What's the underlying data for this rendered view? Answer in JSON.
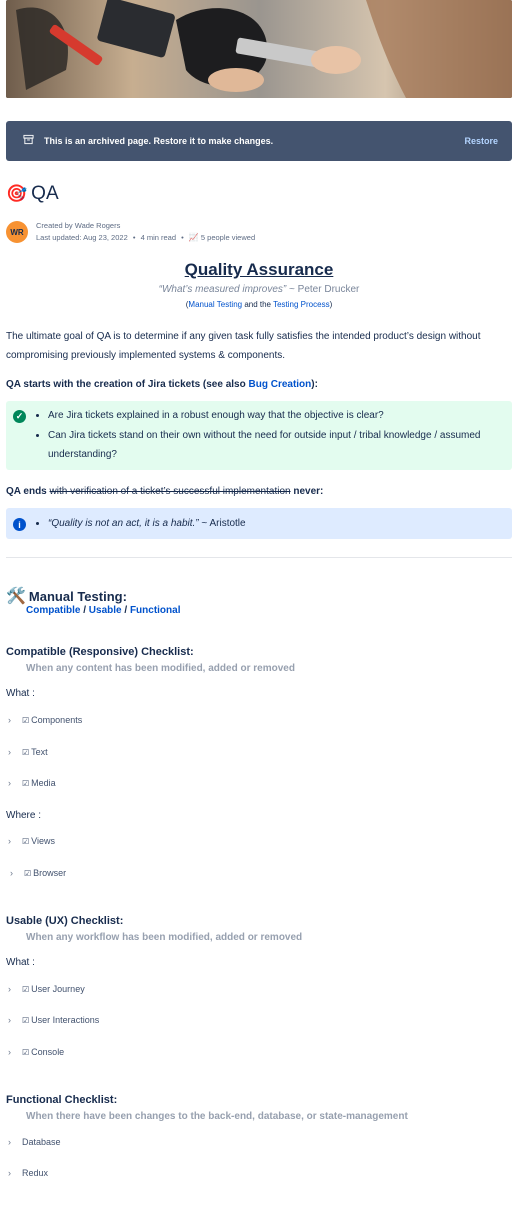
{
  "archive": {
    "message": "This is an archived page. Restore it to make changes.",
    "restore": "Restore"
  },
  "page": {
    "title": "QA",
    "emoji": "🎯"
  },
  "meta": {
    "avatar": "WR",
    "created_by": "Created by Wade Rogers",
    "updated": "Last updated: Aug 23, 2022",
    "read": "4 min read",
    "views": "5 people viewed"
  },
  "header": {
    "title": "Quality Assurance",
    "quote": "“What’s measured improves”",
    "quote_author": " ~ Peter Drucker",
    "links": {
      "open": "(",
      "manual": "Manual Testing",
      "and": " and the ",
      "process": "Testing Process",
      "close": ")"
    }
  },
  "intro": "The ultimate goal of QA is to determine if any given task fully satisfies the intended product’s design without compromising previously implemented systems & components.",
  "starts": {
    "text": "QA starts with the creation of Jira tickets (see also ",
    "link": "Bug Creation",
    "end": "):"
  },
  "success_panel": {
    "items": [
      "Are Jira tickets explained in a robust enough way that the objective is clear?",
      "Can Jira tickets stand on their own without the need for outside input / tribal knowledge / assumed understanding?"
    ]
  },
  "ends": {
    "prefix": "QA ends ",
    "struck": "with verification of a ticket’s successful implementation",
    "suffix": " never:"
  },
  "info_panel": {
    "quote": "“Quality is not an act, it is a habit.”",
    "author": " ~ Aristotle"
  },
  "manual": {
    "emoji": "🛠️",
    "title": "Manual Testing:",
    "links": [
      "Compatible",
      "Usable",
      "Functional"
    ],
    "sep": " / "
  },
  "compatible": {
    "title": "Compatible (Responsive) Checklist:",
    "desc": "When any content has been modified, added or removed",
    "what": "What :",
    "what_items": [
      "Components",
      "Text",
      "Media"
    ],
    "where": "Where :",
    "where_items": [
      "Views",
      "Browser"
    ]
  },
  "usable": {
    "title": "Usable (UX) Checklist:",
    "desc": "When any workflow has been modified, added or removed",
    "what": "What :",
    "items": [
      "User Journey",
      "User Interactions",
      "Console"
    ]
  },
  "functional": {
    "title": "Functional Checklist:",
    "desc": "When there have been changes to the back-end, database, or state-management",
    "items": [
      "Database",
      "Redux"
    ]
  },
  "colors": {
    "archive_bg": "#44546f",
    "link": "#0052cc",
    "success_bg": "#e3fcef",
    "info_bg": "#deebff",
    "avatar": "#f79232"
  }
}
